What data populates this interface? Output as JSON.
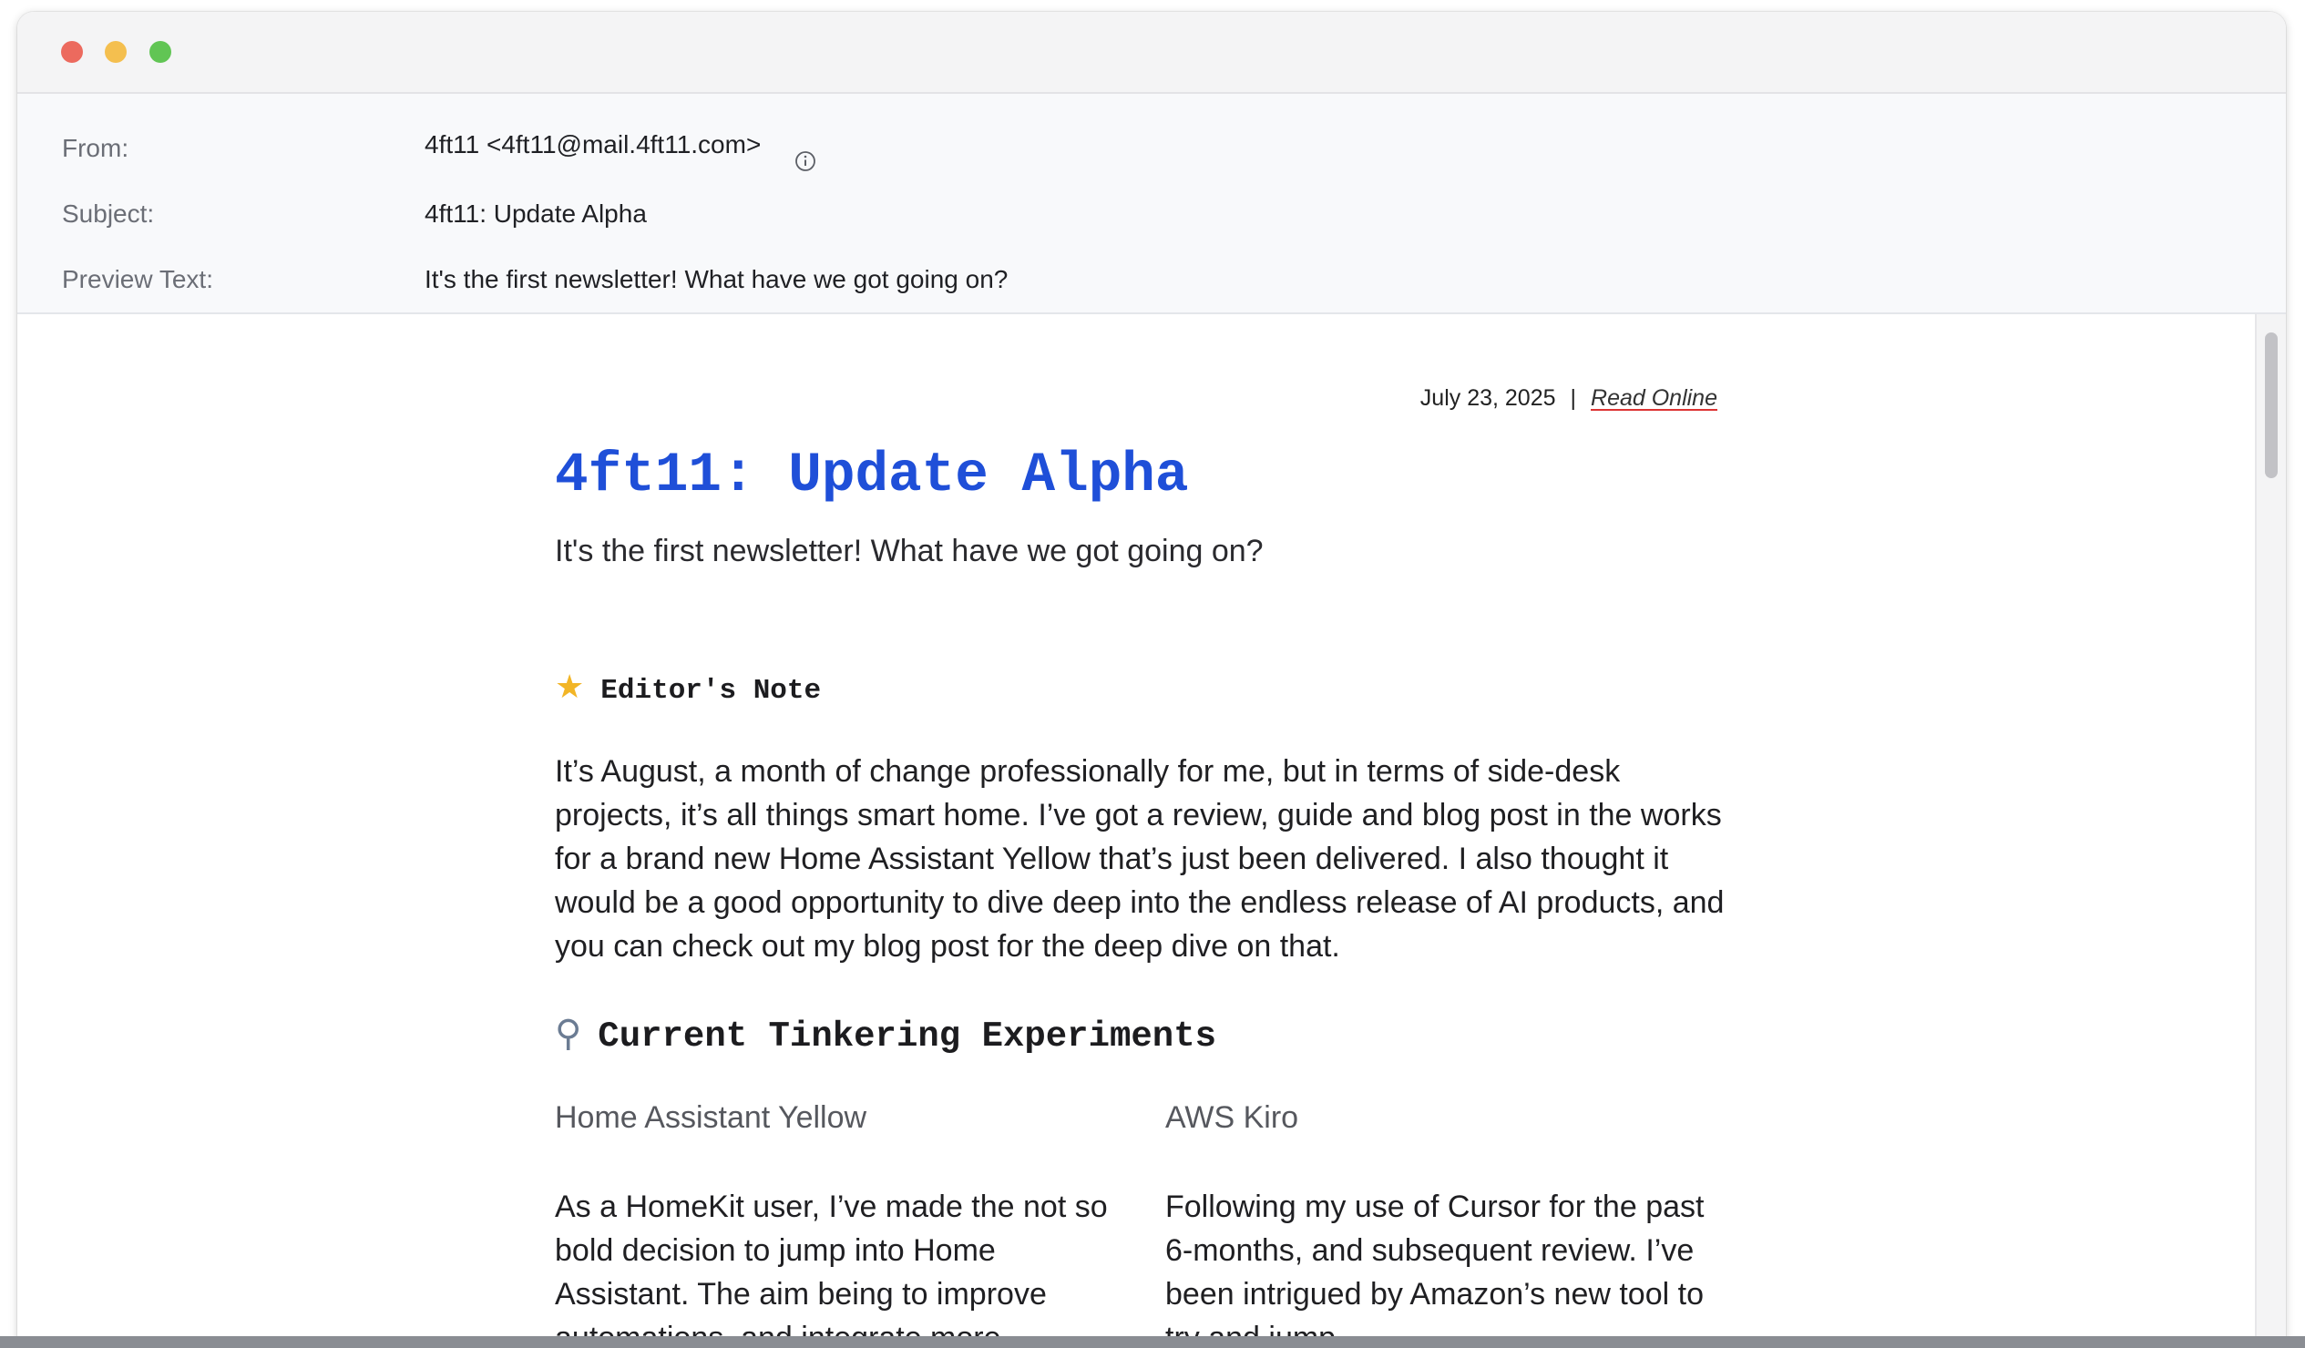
{
  "window": {
    "traffic_lights": [
      "close",
      "minimize",
      "maximize"
    ],
    "colors": {
      "close": "#ec6a5e",
      "minimize": "#f4bf4f",
      "maximize": "#61c554"
    }
  },
  "header": {
    "from_label": "From:",
    "from_value": "4ft11 <4ft11@mail.4ft11.com>",
    "subject_label": "Subject:",
    "subject_value": "4ft11: Update Alpha",
    "preview_label": "Preview Text:",
    "preview_value": "It's the first newsletter! What have we got going on?"
  },
  "email": {
    "date": "July 23, 2025",
    "separator": "|",
    "read_online": "Read Online",
    "title": "4ft11: Update Alpha",
    "subtitle": "It's the first newsletter! What have we got going on?",
    "title_color": "#1f4fd8",
    "editors_note": {
      "icon": "glowing-star-icon",
      "heading": "Editor's Note",
      "body": "It’s August, a month of change professionally for me, but in terms of side-desk projects, it’s all things smart home. I’ve got a review, guide and blog post in the works for a brand new Home Assistant Yellow that’s just been delivered. I also thought it would be a good opportunity to dive deep into the endless release of AI products, and you can check out my blog post for the deep dive on that."
    },
    "tinkering": {
      "icon": "microscope-icon",
      "heading": "Current Tinkering Experiments",
      "items": [
        {
          "title": "Home Assistant Yellow",
          "text": "As a HomeKit user, I’ve made the not so bold decision to jump into Home Assistant. The aim being to improve automations, and integrate more"
        },
        {
          "title": "AWS Kiro",
          "text": "Following my use of Cursor for the past 6-months, and subsequent review. I’ve been intrigued by Amazon’s new tool to try and jump"
        }
      ]
    }
  }
}
